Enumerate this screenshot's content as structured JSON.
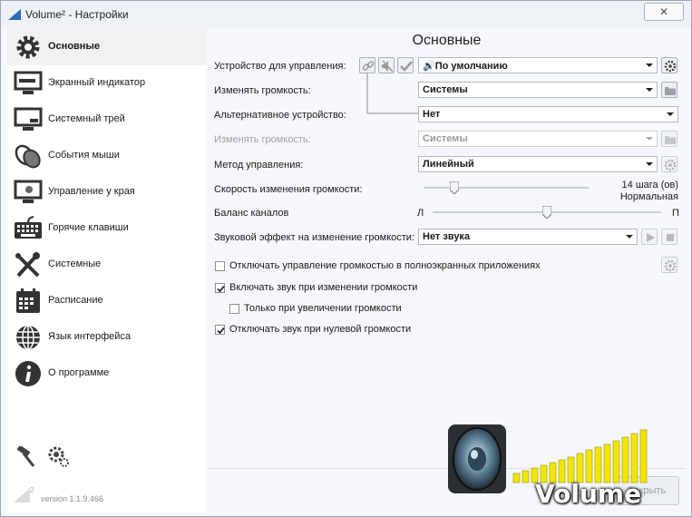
{
  "window": {
    "title": "Volume² - Настройки",
    "close_label": "✕"
  },
  "sidebar": {
    "items": [
      {
        "label": "Основные",
        "icon": "gear-icon"
      },
      {
        "label": "Экранный индикатор",
        "icon": "monitor-icon"
      },
      {
        "label": "Системный трей",
        "icon": "tray-icon"
      },
      {
        "label": "События мыши",
        "icon": "mouse-icon"
      },
      {
        "label": "Управление у края",
        "icon": "screen-edge-icon"
      },
      {
        "label": "Горячие клавиши",
        "icon": "keyboard-icon"
      },
      {
        "label": "Системные",
        "icon": "tools-icon"
      },
      {
        "label": "Расписание",
        "icon": "calendar-icon"
      },
      {
        "label": "Язык интерфейса",
        "icon": "globe-icon"
      },
      {
        "label": "О программе",
        "icon": "info-icon"
      }
    ],
    "version": "version 1.1.9.466",
    "version_mark": "2"
  },
  "main": {
    "title": "Основные",
    "device_label": "Устройство для управления:",
    "device_value": "🔊По умолчанию",
    "change_volume_label": "Изменять громкость:",
    "change_volume_value": "Системы",
    "alt_device_label": "Альтернативное устройство:",
    "alt_device_value": "Нет",
    "alt_change_volume_label": "Изменять громкость:",
    "alt_change_volume_value": "Системы",
    "method_label": "Метод управления:",
    "method_value": "Линейный",
    "speed_label": "Скорость изменения громкости:",
    "speed_text1": "14 шага (ов)",
    "speed_text2": "Нормальная",
    "speed_level": 0.17,
    "balance_label": "Баланс каналов",
    "balance_left": "Л",
    "balance_right": "П",
    "balance_level": 0.5,
    "sound_effect_label": "Звуковой эффект на изменение громкости:",
    "sound_effect_value": "Нет звука",
    "checkboxes": [
      {
        "label": "Отключать управление громкостью в полноэкранных приложениях",
        "checked": false
      },
      {
        "label": "Включать звук при изменении громкости",
        "checked": true
      },
      {
        "label": "Только при увеличении громкости",
        "checked": false
      },
      {
        "label": "Отключать звук при нулевой громкости",
        "checked": true
      }
    ]
  },
  "footer": {
    "close_button": "Закрыть",
    "logo_text": "Volume"
  },
  "colors": {
    "accent": "#2c6bb8",
    "logo_yellow": "#f2e600"
  }
}
